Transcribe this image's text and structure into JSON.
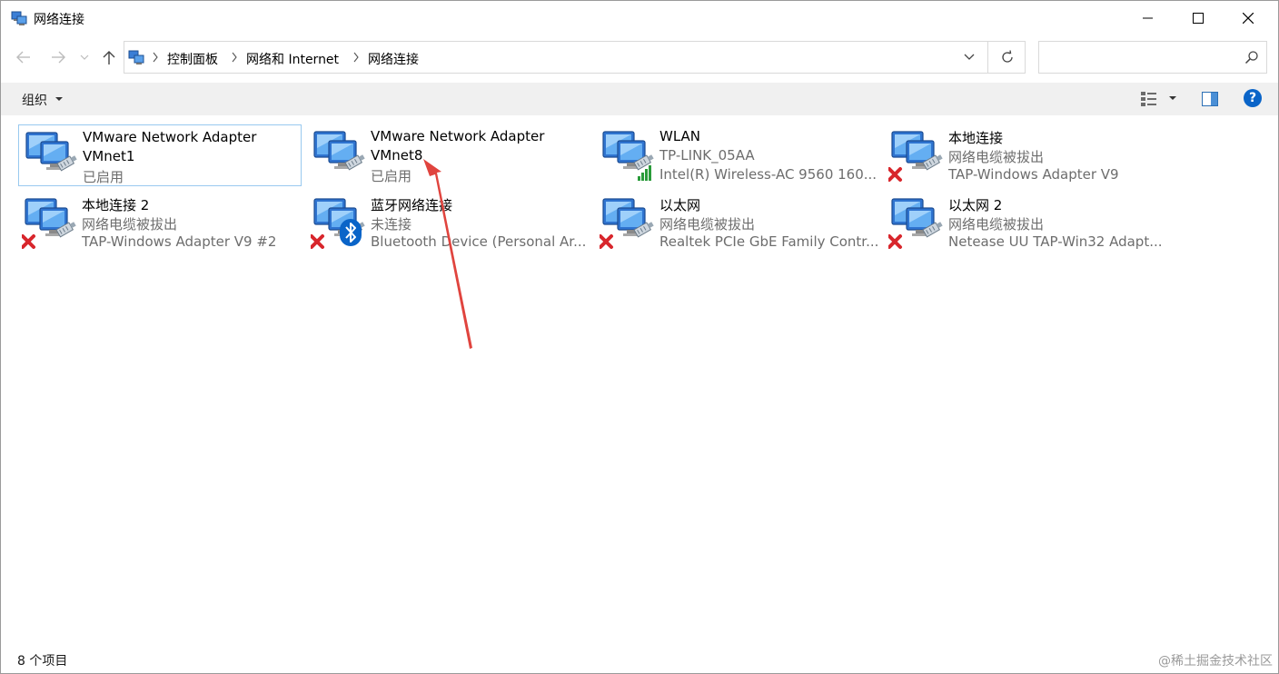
{
  "window": {
    "title": "网络连接"
  },
  "breadcrumbs": [
    "控制面板",
    "网络和 Internet",
    "网络连接"
  ],
  "search": {
    "placeholder": ""
  },
  "toolbar": {
    "organize_label": "组织",
    "help_label": "?"
  },
  "adapters": [
    {
      "name": "VMware Network Adapter",
      "name2": "VMnet1",
      "status": "已启用",
      "device": "",
      "icon": "network-adapter-icon",
      "badge": "none",
      "selected": true
    },
    {
      "name": "VMware Network Adapter",
      "name2": "VMnet8",
      "status": "已启用",
      "device": "",
      "icon": "network-adapter-icon",
      "badge": "none",
      "selected": false
    },
    {
      "name": "WLAN",
      "status": "TP-LINK_05AA",
      "device": "Intel(R) Wireless-AC 9560 160...",
      "icon": "network-adapter-icon",
      "badge": "wifi-signal",
      "selected": false
    },
    {
      "name": "本地连接",
      "status": "网络电缆被拔出",
      "device": "TAP-Windows Adapter V9",
      "icon": "network-adapter-icon",
      "badge": "disconnected",
      "selected": false
    },
    {
      "name": "本地连接 2",
      "status": "网络电缆被拔出",
      "device": "TAP-Windows Adapter V9 #2",
      "icon": "network-adapter-icon",
      "badge": "disconnected",
      "selected": false
    },
    {
      "name": "蓝牙网络连接",
      "status": "未连接",
      "device": "Bluetooth Device (Personal Ar...",
      "icon": "bluetooth-adapter-icon",
      "badge": "disconnected-bluetooth",
      "selected": false
    },
    {
      "name": "以太网",
      "status": "网络电缆被拔出",
      "device": "Realtek PCIe GbE Family Contr...",
      "icon": "network-adapter-icon",
      "badge": "disconnected",
      "selected": false
    },
    {
      "name": "以太网 2",
      "status": "网络电缆被拔出",
      "device": "Netease UU TAP-Win32 Adapt...",
      "icon": "network-adapter-icon",
      "badge": "disconnected",
      "selected": false
    }
  ],
  "statusbar": {
    "count_text": "8 个项目"
  },
  "watermark": {
    "text": "@稀土掘金技术社区"
  },
  "colors": {
    "accent": "#0a64c8",
    "selection_border": "#99c9ef",
    "annotation_arrow": "#e0443e",
    "error_red": "#d8262c"
  }
}
